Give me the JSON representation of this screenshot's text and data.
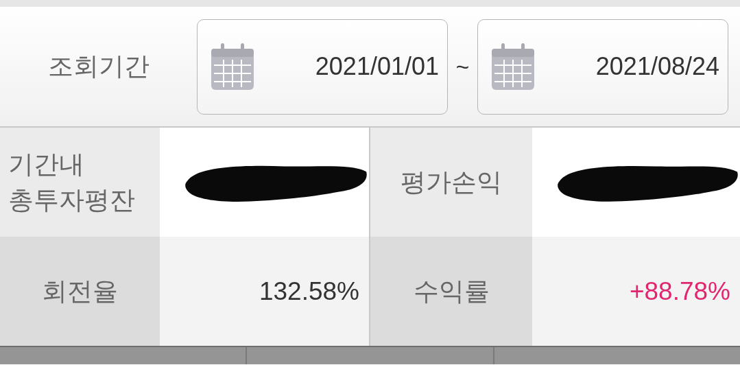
{
  "period": {
    "label": "조회기간",
    "start": "2021/01/01",
    "separator": "~",
    "end": "2021/08/24"
  },
  "rows": [
    {
      "cells": [
        {
          "kind": "label",
          "lines": [
            "기간내",
            "총투자평잔"
          ]
        },
        {
          "kind": "redacted"
        },
        {
          "kind": "label",
          "lines": [
            "평가손익"
          ]
        },
        {
          "kind": "redacted"
        }
      ]
    },
    {
      "cells": [
        {
          "kind": "label",
          "lines": [
            "회전율"
          ]
        },
        {
          "kind": "value",
          "text": "132.58%",
          "color": "#333333"
        },
        {
          "kind": "label",
          "lines": [
            "수익률"
          ]
        },
        {
          "kind": "value",
          "text": "+88.78%",
          "color": "#e0266f"
        }
      ]
    }
  ]
}
